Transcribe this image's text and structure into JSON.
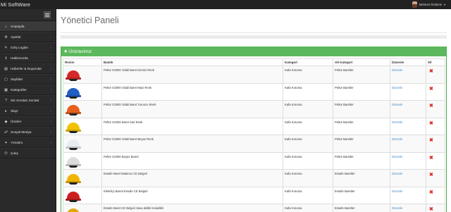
{
  "app": {
    "brand": "Mi SoftWare"
  },
  "user": {
    "name": "Mehmet Özdemir"
  },
  "sidebar": {
    "items": [
      {
        "label": "Anasayfa",
        "icon": "home-icon"
      },
      {
        "label": "Ayarlar",
        "icon": "settings-icon"
      },
      {
        "label": "Giriş Logları",
        "icon": "log-icon"
      },
      {
        "label": "Hakkımızda",
        "icon": "info-icon"
      },
      {
        "label": "Haberler & Duyurular",
        "icon": "news-icon"
      },
      {
        "label": "Sayfalar",
        "icon": "pages-icon"
      },
      {
        "label": "Kategoriler",
        "icon": "category-icon"
      },
      {
        "label": "Sık Sorulan Sorular",
        "icon": "faq-icon"
      },
      {
        "label": "Slayt",
        "icon": "slide-icon"
      },
      {
        "label": "Ürünler",
        "icon": "product-icon"
      },
      {
        "label": "Sosyal Medya",
        "icon": "social-icon"
      },
      {
        "label": "Yönetim",
        "icon": "admin-icon"
      },
      {
        "label": "Çıkış",
        "icon": "logout-icon"
      }
    ]
  },
  "main": {
    "title": "Yönetici Paneli",
    "panel_title": "Ürünlerimiz"
  },
  "table": {
    "headers": [
      "Resim",
      "Baslık",
      "Kategori",
      "Alt Kategori",
      "Düzenle",
      "Sil"
    ],
    "rows": [
      {
        "title": "Peltor G3000 Vidali Baret Kirmizi Renk",
        "category": "Kafa Koruma",
        "subcategory": "Peltor Baretler",
        "edit": "Düzenle",
        "helmet_color": "#d62828"
      },
      {
        "title": "Peltor G3000 Vidali Baret Mavi Renk",
        "category": "Kafa Koruma",
        "subcategory": "Peltor Baretler",
        "edit": "Düzenle",
        "helmet_color": "#1f5fc4"
      },
      {
        "title": "Peltor G3000 Vidali Baret Turuncu Renk",
        "category": "Kafa Koruma",
        "subcategory": "Peltor Baretler",
        "edit": "Düzenle",
        "helmet_color": "#e8611c"
      },
      {
        "title": "Peltor G2000 Baret Sari Renk",
        "category": "Kafa Koruma",
        "subcategory": "Peltor Baretler",
        "edit": "Düzenle",
        "helmet_color": "#f2c200"
      },
      {
        "title": "Peltor G3000 Vidali Baret Beyaz Renk",
        "category": "Kafa Koruma",
        "subcategory": "Peltor Baretler",
        "edit": "Düzenle",
        "helmet_color": "#e6ecf2"
      },
      {
        "title": "Peltor G2000 Beyaz Bareti",
        "category": "Kafa Koruma",
        "subcategory": "Peltor Baretler",
        "edit": "Düzenle",
        "helmet_color": "#dcdcdc"
      },
      {
        "title": "Essafe Baret Madenci CE Belgeli",
        "category": "Kafa Koruma",
        "subcategory": "Essafe Baretler",
        "edit": "Düzenle",
        "helmet_color": "#f0b400"
      },
      {
        "title": "Elekrikçi Bareti Essafe CE Belgeli",
        "category": "Kafa Koruma",
        "subcategory": "Essafe Baretler",
        "edit": "Düzenle",
        "helmet_color": "#cc1f1f"
      },
      {
        "title": "Essafe Baret CE Belgeli Hava delikli Kulaklikli",
        "category": "Kafa Koruma",
        "subcategory": "Essafe Baretler",
        "edit": "Düzenle",
        "helmet_color": "#e0a800"
      }
    ]
  },
  "colors": {
    "topbar": "#222222",
    "sidebar": "#2a2a2a",
    "panel_header": "#5cb85c",
    "link": "#428bca",
    "delete": "#d9312b"
  }
}
